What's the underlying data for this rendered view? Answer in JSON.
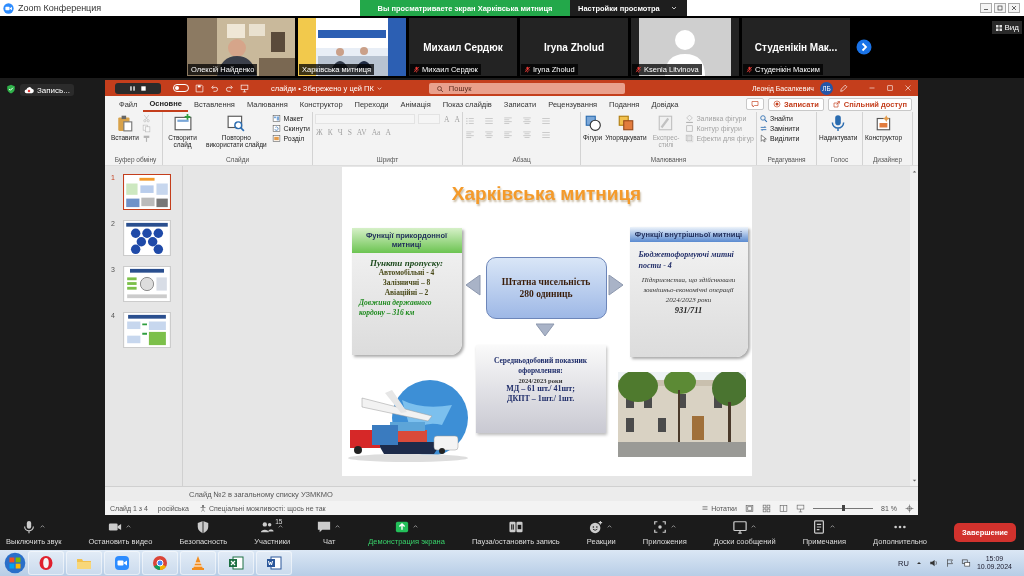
{
  "zoom_window": {
    "title": "Zoom Конференция",
    "share_banner": "Вы просматриваете экран Харківська митниця",
    "view_options": "Настройки просмотра"
  },
  "participants": [
    {
      "kind": "video",
      "name": "Олексій Найденко",
      "muted": false
    },
    {
      "kind": "video",
      "name": "Харківська митниця",
      "muted": false
    },
    {
      "kind": "name",
      "display": "Михаил Сердюк",
      "name": "Михаил Сердюк",
      "muted": true
    },
    {
      "kind": "name",
      "display": "Iryna Zholud",
      "name": "Iryna Zholud",
      "muted": true
    },
    {
      "kind": "avatar",
      "name": "Ksenia Litvinova",
      "muted": true
    },
    {
      "kind": "name",
      "display": "Студенікін Мак...",
      "name": "Студенікін Максим",
      "muted": true
    }
  ],
  "view_button": "Вид",
  "recording": {
    "label": "Запись..."
  },
  "powerpoint": {
    "autosave": {
      "on": false
    },
    "title": "слайди • Збережено у цей ПК",
    "search_placeholder": "Пошук",
    "user": "Леонід Басалкевич",
    "user_initials": "ЛБ",
    "tabs": [
      {
        "label": "Файл",
        "selected": false
      },
      {
        "label": "Основне",
        "selected": true
      },
      {
        "label": "Вставлення",
        "selected": false
      },
      {
        "label": "Малювання",
        "selected": false
      },
      {
        "label": "Конструктор",
        "selected": false
      },
      {
        "label": "Переходи",
        "selected": false
      },
      {
        "label": "Анімація",
        "selected": false
      },
      {
        "label": "Показ слайдів",
        "selected": false
      },
      {
        "label": "Записати",
        "selected": false
      },
      {
        "label": "Рецензування",
        "selected": false
      },
      {
        "label": "Подання",
        "selected": false
      },
      {
        "label": "Довідка",
        "selected": false
      }
    ],
    "record_button": "Записати",
    "share_button": "Спільний доступ",
    "ribbon": [
      {
        "label": "Буфер обміну",
        "items": [
          {
            "kind": "large",
            "label": "Вставити",
            "disabled": false
          },
          {
            "kind": "iconstack",
            "disabled": true
          }
        ]
      },
      {
        "label": "Слайди",
        "items": [
          {
            "kind": "large",
            "label": "Створити слайд",
            "disabled": false
          },
          {
            "kind": "large",
            "label": "Повторно використати слайди",
            "disabled": false
          },
          {
            "kind": "stack",
            "disabled": false,
            "labels": [
              "Макет",
              "Скинути",
              "Розділ"
            ]
          }
        ]
      },
      {
        "label": "Шрифт",
        "items": [
          {
            "kind": "font",
            "disabled": true,
            "row1": [
              "A",
              "A"
            ],
            "row2": [
              "Ж",
              "К",
              "Ч",
              "S",
              "AV",
              "Aa",
              "A"
            ]
          }
        ]
      },
      {
        "label": "Абзац",
        "items": [
          {
            "kind": "paragraph",
            "disabled": true
          }
        ]
      },
      {
        "label": "Малювання",
        "items": [
          {
            "kind": "large",
            "label": "Фігури",
            "disabled": false
          },
          {
            "kind": "large",
            "label": "Упорядкувати",
            "disabled": false
          },
          {
            "kind": "large",
            "label": "Експрес-стилі",
            "disabled": true
          },
          {
            "kind": "stack",
            "disabled": true,
            "labels": [
              "Заливка фігури",
              "Контур фігури",
              "Ефекти для фігур"
            ]
          }
        ]
      },
      {
        "label": "Редагування",
        "items": [
          {
            "kind": "stack",
            "disabled": false,
            "labels": [
              "Знайти",
              "Замінити",
              "Виділити"
            ]
          }
        ]
      },
      {
        "label": "Голос",
        "items": [
          {
            "kind": "large",
            "label": "Надиктувати",
            "disabled": false
          }
        ]
      },
      {
        "label": "Дизайнер",
        "items": [
          {
            "kind": "large",
            "label": "Конструктор",
            "disabled": false
          }
        ]
      }
    ],
    "thumbnails": [
      {
        "number": "1",
        "selected": true
      },
      {
        "number": "2",
        "selected": false
      },
      {
        "number": "3",
        "selected": false
      },
      {
        "number": "4",
        "selected": false
      }
    ],
    "slide": {
      "title": "Харківська митниця",
      "left_box": {
        "heading": "Функції прикордонної митниці",
        "subheading": "Пункти пропуску:",
        "lines": [
          "Автомобільні - 4",
          "Залізничні – 8",
          "Авіаційні – 2"
        ],
        "note": "Довжина державного кордону – 316 км"
      },
      "center_box": {
        "lines": [
          "Штатна чисельність",
          "280 одиниць"
        ]
      },
      "stats_box": {
        "heading": "Середньодобовий показник оформлення:",
        "period": "2024/2023 роки",
        "lines": [
          "МД – 61 шт./ 41шт;",
          "ДКПТ – 1шт./ 1шт."
        ]
      },
      "right_box": {
        "heading": "Функції внутрішньої митниці",
        "subheading": "Бюджетоформуючі митні пости - 4",
        "text": "Підприємства, що здійснювали зовнішньо-економічні операції 2024/2023 роки",
        "figure": "931/711"
      }
    },
    "notes": "Слайд №2 в загальному списку УЗМКМО",
    "status": {
      "slide": "Слайд 1 з 4",
      "language": "російська",
      "accessibility": "Спеціальні можливості: щось не так",
      "notes_button": "Нотатки",
      "zoom_slider": {
        "level": 0.5
      },
      "zoom": "81 %"
    }
  },
  "toolbar": [
    {
      "label": "Выключить звук",
      "menu": true,
      "active": false
    },
    {
      "label": "Остановить видео",
      "menu": true,
      "active": false
    },
    {
      "label": "Безопасность",
      "menu": false,
      "active": false
    },
    {
      "label": "Участники",
      "count": "15",
      "menu": true,
      "active": false
    },
    {
      "label": "Чат",
      "menu": true,
      "active": false
    },
    {
      "label": "Демонстрация экрана",
      "menu": true,
      "active": true
    },
    {
      "label": "Пауза/остановить запись",
      "menu": false,
      "active": false
    },
    {
      "label": "Реакции",
      "menu": true,
      "active": false
    },
    {
      "label": "Приложения",
      "menu": true,
      "active": false
    },
    {
      "label": "Доски сообщений",
      "menu": true,
      "active": false
    },
    {
      "label": "Примечания",
      "menu": true,
      "active": false
    },
    {
      "label": "Дополнительно",
      "menu": false,
      "active": false
    }
  ],
  "end_button": "Завершение",
  "taskbar": {
    "language": "RU",
    "time": "15:09",
    "date": "10.09.2024"
  }
}
